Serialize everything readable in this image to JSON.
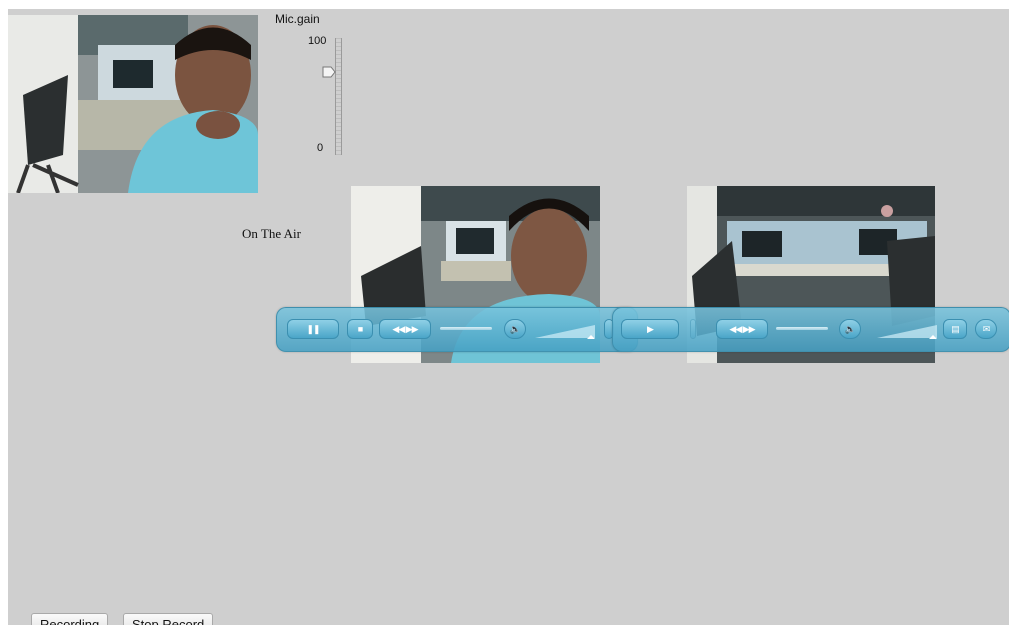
{
  "mic": {
    "title": "Mic.gain",
    "max_label": "100",
    "min_label": "0",
    "level_percent": 72
  },
  "status": {
    "on_air": "On The Air"
  },
  "players": [
    {
      "play_state": "playing"
    },
    {
      "play_state": "paused"
    }
  ],
  "buttons": {
    "recording": "Recording",
    "stop_record": "Stop Record"
  },
  "colors": {
    "background": "#cfcfcf",
    "control_bar": "#5fb4d4",
    "control_button": "#4aa5c8"
  }
}
